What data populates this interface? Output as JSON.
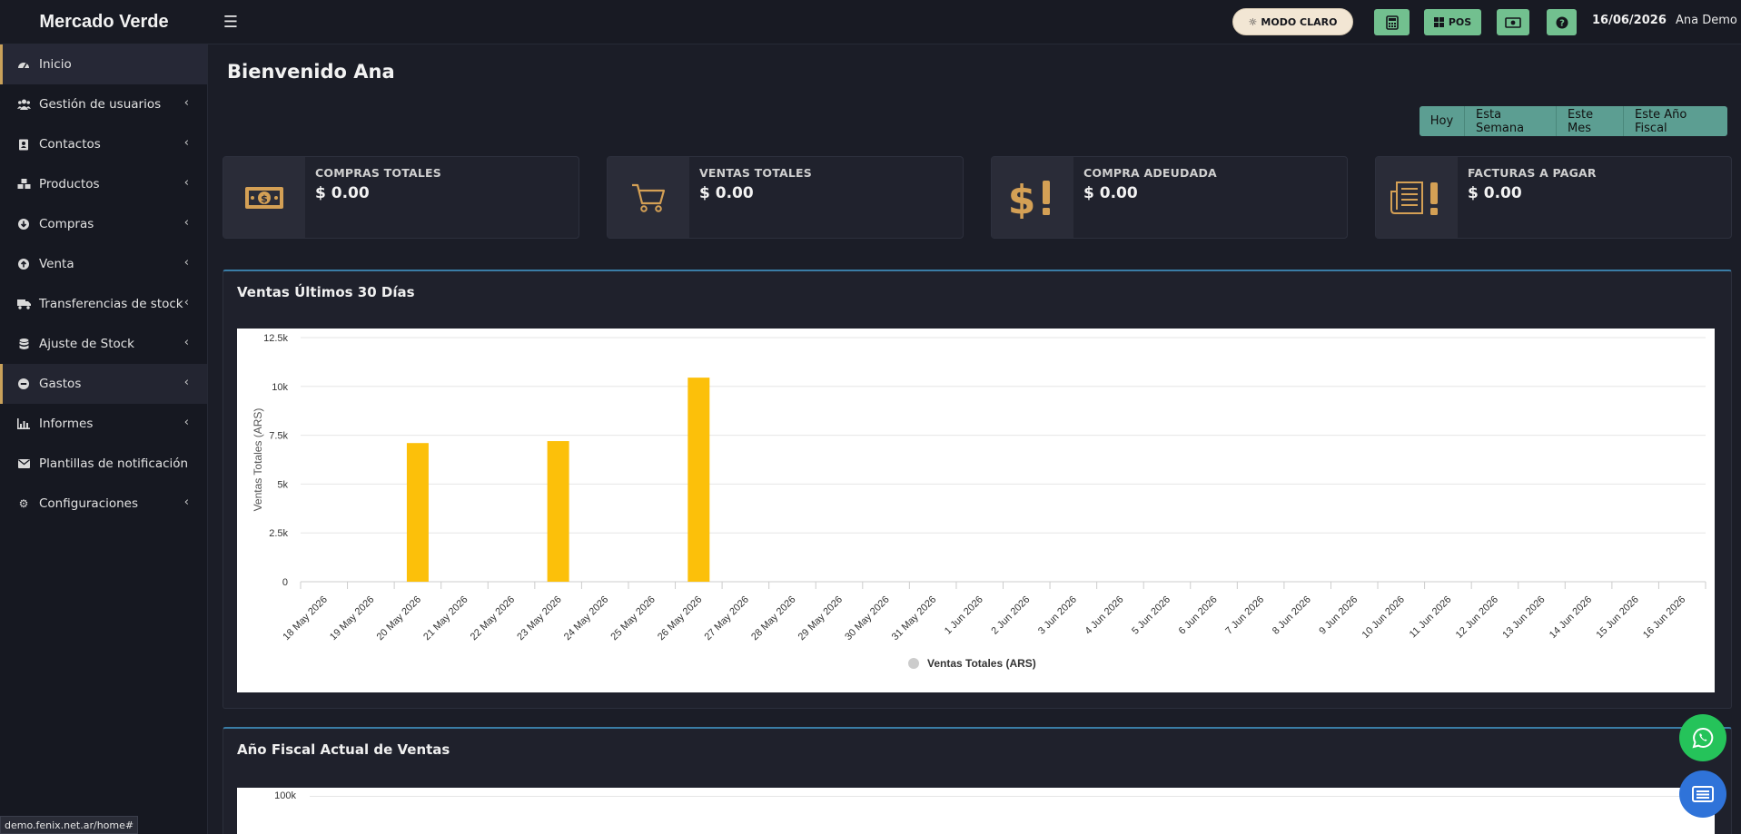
{
  "app": {
    "brand": "Mercado Verde"
  },
  "navbar": {
    "mode_label": "MODO CLARO",
    "pos_label": "POS",
    "date": "16/06/2026",
    "user": "Ana Demo"
  },
  "sidebar": {
    "items": [
      {
        "label": "Inicio",
        "icon": "dashboard-icon"
      },
      {
        "label": "Gestión de usuarios",
        "icon": "users-icon"
      },
      {
        "label": "Contactos",
        "icon": "address-book-icon"
      },
      {
        "label": "Productos",
        "icon": "cubes-icon"
      },
      {
        "label": "Compras",
        "icon": "arrow-circle-down-icon"
      },
      {
        "label": "Venta",
        "icon": "arrow-circle-up-icon"
      },
      {
        "label": "Transferencias de stock",
        "icon": "truck-icon"
      },
      {
        "label": "Ajuste de Stock",
        "icon": "database-icon"
      },
      {
        "label": "Gastos",
        "icon": "minus-circle-icon"
      },
      {
        "label": "Informes",
        "icon": "bar-chart-icon"
      },
      {
        "label": "Plantillas de notificación",
        "icon": "envelope-icon"
      },
      {
        "label": "Configuraciones",
        "icon": "cog-icon"
      }
    ]
  },
  "main": {
    "title": "Bienvenido Ana",
    "filters": [
      "Hoy",
      "Esta Semana",
      "Este Mes",
      "Este Año Fiscal"
    ],
    "stats": [
      {
        "label": "COMPRAS TOTALES",
        "value": "$ 0.00",
        "icon": "money-bill-icon"
      },
      {
        "label": "VENTAS TOTALES",
        "value": "$ 0.00",
        "icon": "shopping-cart-icon"
      },
      {
        "label": "COMPRA ADEUDADA",
        "value": "$ 0.00",
        "icon": "dollar-exclamation-icon"
      },
      {
        "label": "FACTURAS A PAGAR",
        "value": "$ 0.00",
        "icon": "invoice-exclamation-icon"
      }
    ],
    "panel1": {
      "title": "Ventas Últimos 30 Días"
    },
    "panel2": {
      "title": "Año Fiscal Actual de Ventas",
      "first_tick": "100k"
    }
  },
  "colors": {
    "accent": "#c9a15a",
    "bar": "#fcc00a",
    "filter": "#5c9e92",
    "green_btn": "#72c08f",
    "whatsapp": "#25c35a",
    "fab_blue": "#2f73d9"
  },
  "status_url": "demo.fenix.net.ar/home#",
  "chart_data": {
    "type": "bar",
    "title": "",
    "ylabel": "Ventas Totales (ARS)",
    "xlabel": "",
    "ylim": [
      0,
      12500
    ],
    "yticks": [
      "0",
      "2.5k",
      "5k",
      "7.5k",
      "10k",
      "12.5k"
    ],
    "ytick_values": [
      0,
      2500,
      5000,
      7500,
      10000,
      12500
    ],
    "legend": {
      "position": "bottom",
      "label": "Ventas Totales (ARS)"
    },
    "grid": true,
    "categories": [
      "18 May 2026",
      "19 May 2026",
      "20 May 2026",
      "21 May 2026",
      "22 May 2026",
      "23 May 2026",
      "24 May 2026",
      "25 May 2026",
      "26 May 2026",
      "27 May 2026",
      "28 May 2026",
      "29 May 2026",
      "30 May 2026",
      "31 May 2026",
      "1 Jun 2026",
      "2 Jun 2026",
      "3 Jun 2026",
      "4 Jun 2026",
      "5 Jun 2026",
      "6 Jun 2026",
      "7 Jun 2026",
      "8 Jun 2026",
      "9 Jun 2026",
      "10 Jun 2026",
      "11 Jun 2026",
      "12 Jun 2026",
      "13 Jun 2026",
      "14 Jun 2026",
      "15 Jun 2026",
      "16 Jun 2026"
    ],
    "series": [
      {
        "name": "Ventas Totales (ARS)",
        "values": [
          0,
          0,
          7100,
          0,
          0,
          7200,
          0,
          0,
          10450,
          0,
          0,
          0,
          0,
          0,
          0,
          0,
          0,
          0,
          0,
          0,
          0,
          0,
          0,
          0,
          0,
          0,
          0,
          0,
          0,
          0
        ]
      }
    ]
  }
}
